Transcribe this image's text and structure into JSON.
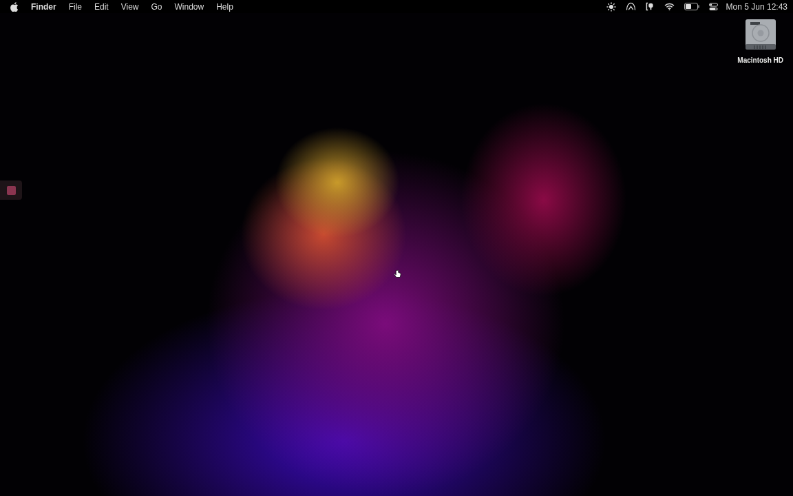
{
  "menu_bar": {
    "app_name": "Finder",
    "menus": [
      "File",
      "Edit",
      "View",
      "Go",
      "Window",
      "Help"
    ],
    "clock": "Mon 5 Jun 12:43"
  },
  "desktop_icons": [
    {
      "label": "Macintosh HD"
    }
  ]
}
